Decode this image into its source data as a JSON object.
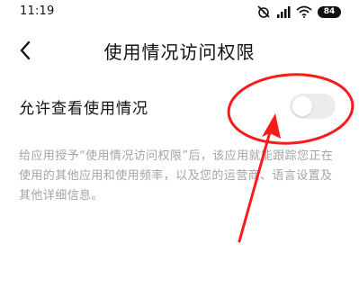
{
  "status_bar": {
    "time": "11:19",
    "battery": "84",
    "icons": [
      "alarm-off-icon",
      "signal-icon",
      "wifi-icon",
      "battery-icon"
    ]
  },
  "header": {
    "back_icon": "chevron-left-icon",
    "title": "使用情况访问权限"
  },
  "setting": {
    "label": "允许查看使用情况",
    "toggle_on": false
  },
  "description": "给应用授予“使用情况访问权限”后，该应用就能跟踪您正在使用的其他应用和使用频率，以及您的运营商、语言设置及其他详细信息。",
  "annotation": {
    "color": "#ff1a1a"
  }
}
